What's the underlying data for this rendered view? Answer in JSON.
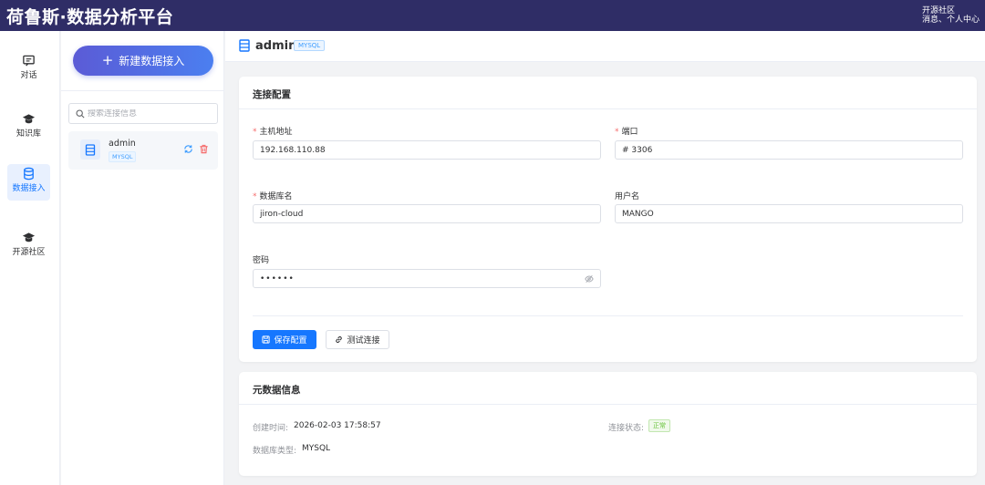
{
  "app": {
    "title": "荷鲁斯·数据分析平台",
    "top_links": [
      "开源社区",
      "消息、个人中心"
    ]
  },
  "rail": {
    "items": [
      {
        "label": "对话",
        "icon": "chat-icon"
      },
      {
        "label": "知识库",
        "icon": "graduation-cap-icon"
      },
      {
        "label": "数据接入",
        "icon": "database-icon",
        "active": true
      },
      {
        "label": "开源社区",
        "icon": "graduation-cap-icon"
      }
    ]
  },
  "connections": {
    "new_button": "新建数据接入",
    "search_placeholder": "搜索连接信息",
    "items": [
      {
        "name": "admin",
        "type": "MYSQL"
      }
    ]
  },
  "main": {
    "title": "admin",
    "type_tag": "MYSQL",
    "config": {
      "title": "连接配置",
      "host_label": "主机地址",
      "host_value": "192.168.110.88",
      "port_label": "端口",
      "port_value": "# 3306",
      "db_label": "数据库名",
      "db_value": "jiron-cloud",
      "user_label": "用户名",
      "user_value": "MANGO",
      "password_label": "密码",
      "password_value": "••••••",
      "save_button": "保存配置",
      "test_button": "测试连接"
    },
    "metadata": {
      "title": "元数据信息",
      "created_label": "创建时间:",
      "created_value": "2026-02-03 17:58:57",
      "status_label": "连接状态:",
      "status_value": "正常",
      "db_type_label": "数据库类型:",
      "db_type_value": "MYSQL"
    }
  },
  "colors": {
    "topbar": "#2f2d66",
    "primary": "#1677ff",
    "danger": "#f56c6c",
    "success": "#67c23a"
  }
}
